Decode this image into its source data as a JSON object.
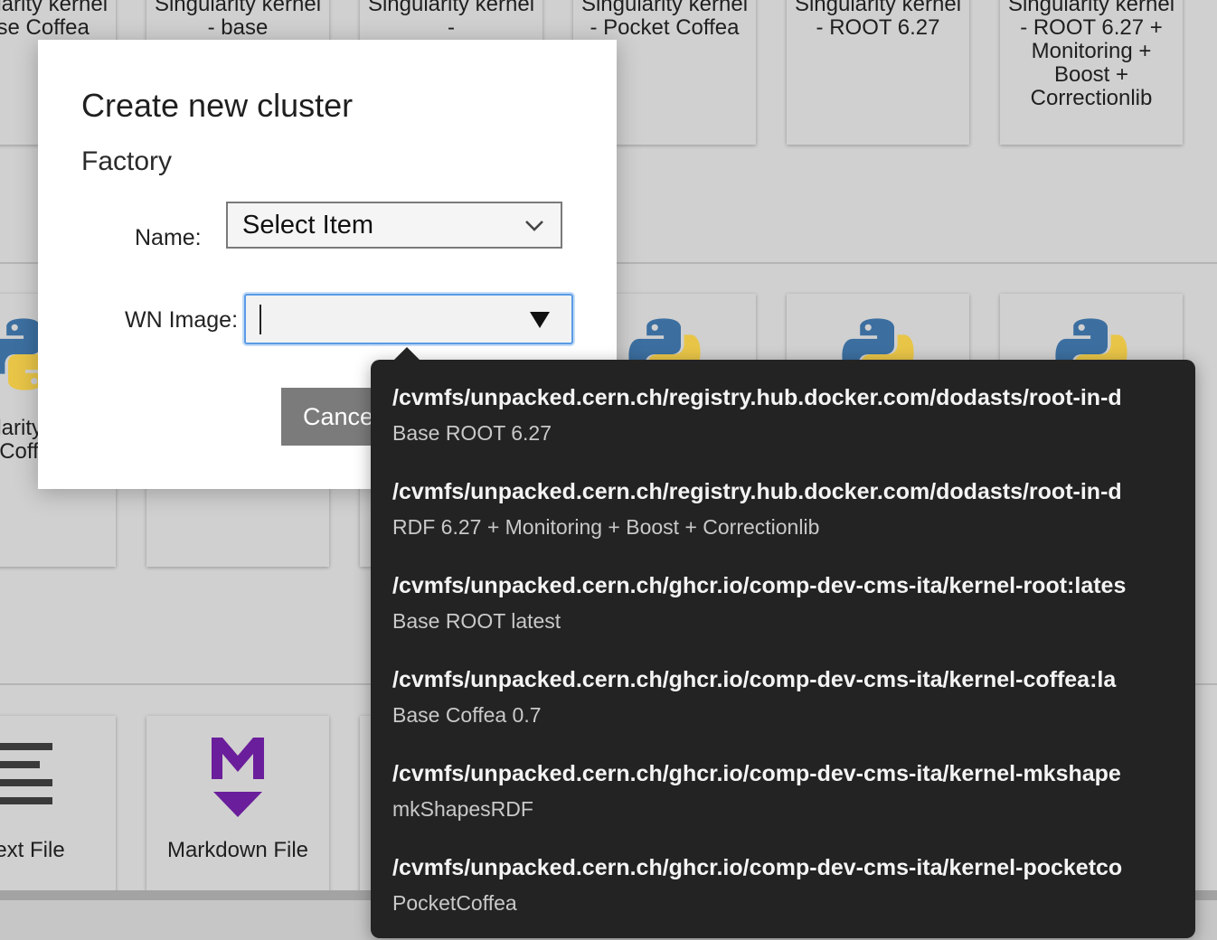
{
  "launcher": {
    "row1": [
      {
        "label": "Singularity kernel - base Coffea"
      },
      {
        "label": "Singularity kernel - base"
      },
      {
        "label": "Singularity kernel -"
      },
      {
        "label": "Singularity kernel - Pocket Coffea"
      },
      {
        "label": "Singularity kernel - ROOT 6.27"
      },
      {
        "label": "Singularity kernel - ROOT 6.27 + Monitoring + Boost + Correctionlib"
      }
    ],
    "row2": [
      {
        "label": "Singularity kernel - Coffea",
        "icon": "python-icon"
      }
    ],
    "row3": [
      {
        "label": "Text File",
        "icon": "text-file-icon"
      },
      {
        "label": "Markdown File",
        "icon": "markdown-icon"
      }
    ]
  },
  "modal": {
    "title": "Create new cluster",
    "section": "Factory",
    "name_label": "Name:",
    "name_value": "Select Item",
    "wn_label": "WN Image:",
    "wn_value": "",
    "cancel_label": "Cancel"
  },
  "dropdown": {
    "options": [
      {
        "path": "/cvmfs/unpacked.cern.ch/registry.hub.docker.com/dodasts/root-in-d",
        "desc": "Base ROOT 6.27"
      },
      {
        "path": "/cvmfs/unpacked.cern.ch/registry.hub.docker.com/dodasts/root-in-d",
        "desc": "RDF 6.27 + Monitoring + Boost + Correctionlib"
      },
      {
        "path": "/cvmfs/unpacked.cern.ch/ghcr.io/comp-dev-cms-ita/kernel-root:lates",
        "desc": "Base ROOT latest"
      },
      {
        "path": "/cvmfs/unpacked.cern.ch/ghcr.io/comp-dev-cms-ita/kernel-coffea:la",
        "desc": "Base Coffea 0.7"
      },
      {
        "path": "/cvmfs/unpacked.cern.ch/ghcr.io/comp-dev-cms-ita/kernel-mkshape",
        "desc": "mkShapesRDF"
      },
      {
        "path": "/cvmfs/unpacked.cern.ch/ghcr.io/comp-dev-cms-ita/kernel-pocketco",
        "desc": "PocketCoffea"
      }
    ]
  },
  "colors": {
    "accent": "#5a9be6",
    "dropdown_bg": "#232323",
    "markdown_purple": "#6a1e9b",
    "python_blue": "#3c6fa0",
    "python_yellow": "#e8c547"
  }
}
